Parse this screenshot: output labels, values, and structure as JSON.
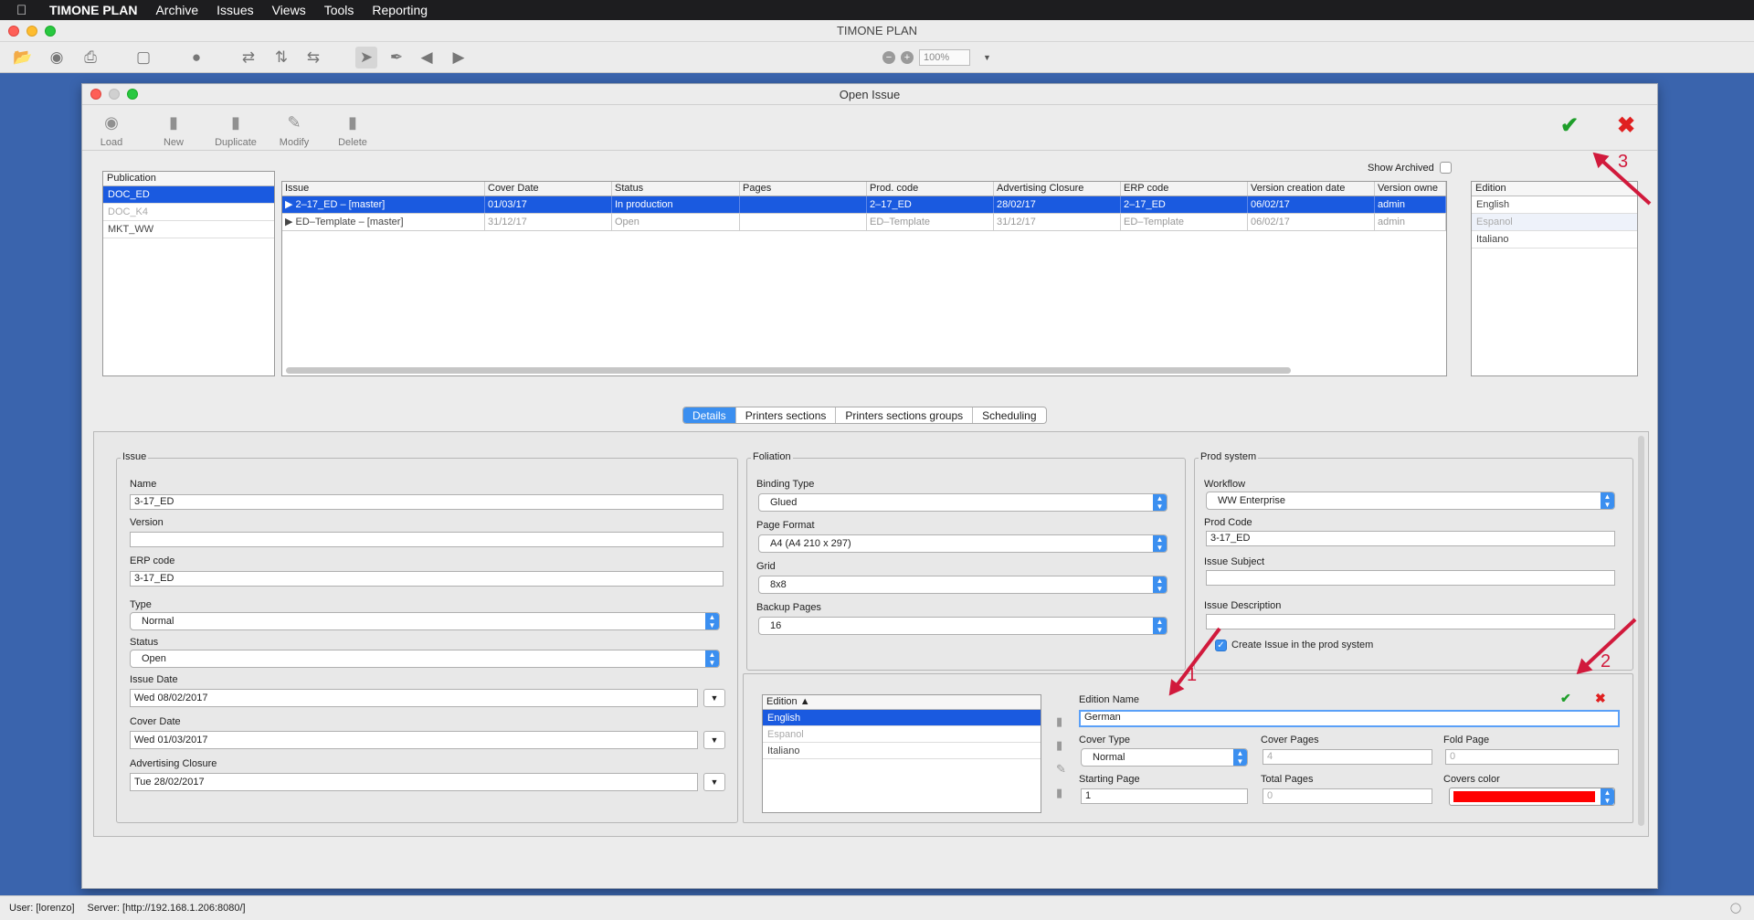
{
  "menubar": {
    "apple_icon": "apple-icon",
    "app_name": "TIMONE PLAN",
    "items": [
      "Archive",
      "Issues",
      "Views",
      "Tools",
      "Reporting"
    ]
  },
  "main_window": {
    "title": "TIMONE PLAN",
    "zoom": "100%"
  },
  "dialog": {
    "title": "Open Issue",
    "toolbar": [
      "Load",
      "New",
      "Duplicate",
      "Modify",
      "Delete"
    ],
    "show_archived": "Show Archived",
    "publication": {
      "header": "Publication",
      "rows": [
        "DOC_ED",
        "DOC_K4",
        "MKT_WW"
      ]
    },
    "issues": {
      "columns": [
        "Issue",
        "Cover Date",
        "Status",
        "Pages",
        "Prod. code",
        "Advertising Closure",
        "ERP code",
        "Version creation date",
        "Version owne"
      ],
      "rows": [
        [
          "▶  2–17_ED – [master]",
          "01/03/17",
          "In production",
          "",
          "2–17_ED",
          "28/02/17",
          "2–17_ED",
          "06/02/17",
          "admin"
        ],
        [
          "▶  ED–Template – [master]",
          "31/12/17",
          "Open",
          "",
          "ED–Template",
          "31/12/17",
          "ED–Template",
          "06/02/17",
          "admin"
        ]
      ]
    },
    "editions_top": {
      "header": "Edition",
      "rows": [
        "English",
        "Espanol",
        "Italiano"
      ]
    },
    "tabs": [
      "Details",
      "Printers sections",
      "Printers sections groups",
      "Scheduling"
    ],
    "issue_group": {
      "legend": "Issue",
      "name_label": "Name",
      "name_value": "3-17_ED",
      "version_label": "Version",
      "version_value": "",
      "erp_label": "ERP code",
      "erp_value": "3-17_ED",
      "type_label": "Type",
      "type_value": "Normal",
      "status_label": "Status",
      "status_value": "Open",
      "issue_date_label": "Issue Date",
      "issue_date_value": "Wed 08/02/2017",
      "cover_date_label": "Cover Date",
      "cover_date_value": "Wed 01/03/2017",
      "adv_label": "Advertising Closure",
      "adv_value": "Tue 28/02/2017"
    },
    "foliation": {
      "legend": "Foliation",
      "binding_label": "Binding Type",
      "binding_value": "Glued",
      "format_label": "Page Format",
      "format_value": "A4 (A4 210 x 297)",
      "grid_label": "Grid",
      "grid_value": "8x8",
      "backup_label": "Backup Pages",
      "backup_value": "16"
    },
    "prod": {
      "legend": "Prod system",
      "workflow_label": "Workflow",
      "workflow_value": "WW Enterprise",
      "code_label": "Prod Code",
      "code_value": "3-17_ED",
      "subject_label": "Issue Subject",
      "subject_value": "",
      "desc_label": "Issue Description",
      "desc_value": "",
      "create_label": "Create Issue in the prod system"
    },
    "edition_panel": {
      "list_header": "Edition ▲",
      "rows": [
        "English",
        "Espanol",
        "Italiano"
      ],
      "name_label": "Edition Name",
      "name_value": "German",
      "cover_type_label": "Cover Type",
      "cover_type_value": "Normal",
      "cover_pages_label": "Cover Pages",
      "cover_pages_value": "4",
      "fold_label": "Fold Page",
      "fold_value": "0",
      "start_label": "Starting Page",
      "start_value": "1",
      "total_label": "Total Pages",
      "total_value": "0",
      "color_label": "Covers color",
      "color_value": "#ff0000"
    },
    "annotations": [
      "1",
      "2",
      "3"
    ]
  },
  "status": {
    "user": "User: [lorenzo]",
    "server": "Server: [http://192.168.1.206:8080/]"
  },
  "colors": {
    "accent": "#3b8ff0",
    "selection": "#1a5ae0",
    "annotation": "#d11a3c",
    "ok": "#1e9e2a",
    "cancel": "#e02020"
  }
}
